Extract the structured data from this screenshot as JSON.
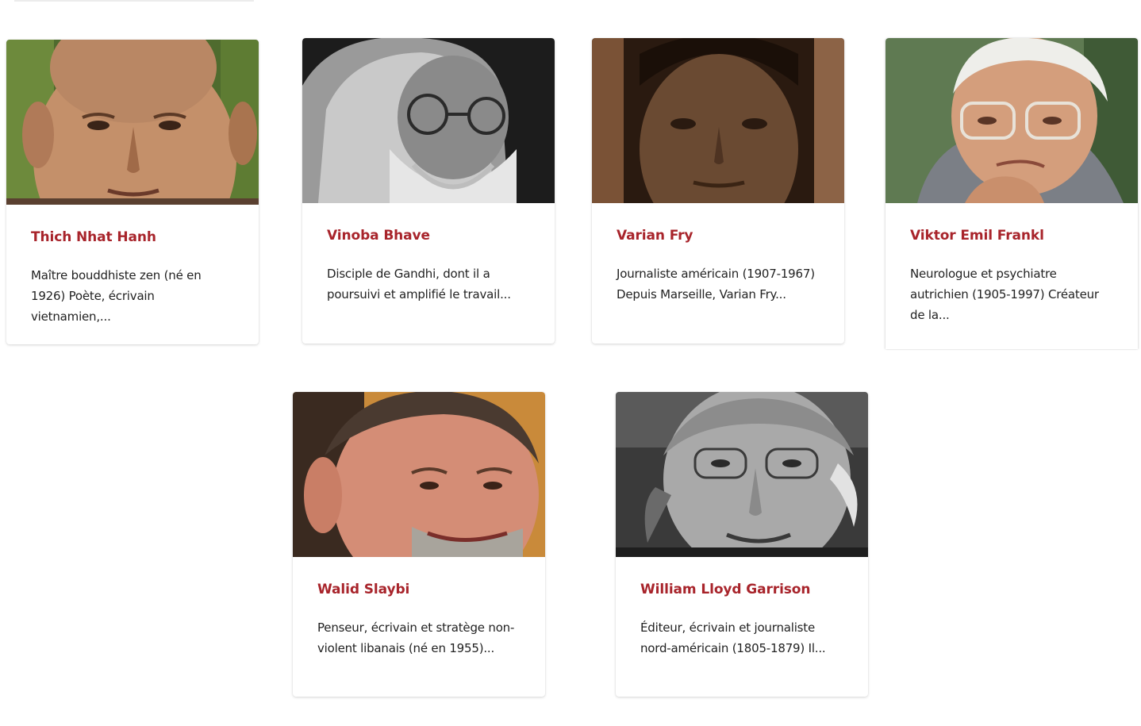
{
  "people": [
    {
      "name": "Thich Nhat Hanh",
      "excerpt": "Maître bouddhiste zen (né en 1926) Poète, écrivain vietnamien,...",
      "portrait": "bald elderly man portrait, green background"
    },
    {
      "name": "Vinoba Bhave",
      "excerpt": "Disciple de Gandhi, dont il a poursuivi et amplifié le travail...",
      "portrait": "black-and-white portrait, white beard, glasses, hood"
    },
    {
      "name": "Varian Fry",
      "excerpt": "Journaliste américain (1907-1967) Depuis Marseille, Varian Fry...",
      "portrait": "sepia portrait of a young man"
    },
    {
      "name": "Viktor Emil Frankl",
      "excerpt": "Neurologue et psychiatre autrichien (1905-1997) Créateur de la...",
      "portrait": "elderly man with glasses, hand on chin"
    },
    {
      "name": "Walid Slaybi",
      "excerpt": "Penseur, écrivain et stratège non-violent libanais (né en 1955)...",
      "portrait": "smiling man with grey beard, warm background"
    },
    {
      "name": "William Lloyd Garrison",
      "excerpt": "Éditeur, écrivain et journaliste nord-américain (1805-1879) Il...",
      "portrait": "black-and-white portrait, elderly man with glasses"
    }
  ]
}
